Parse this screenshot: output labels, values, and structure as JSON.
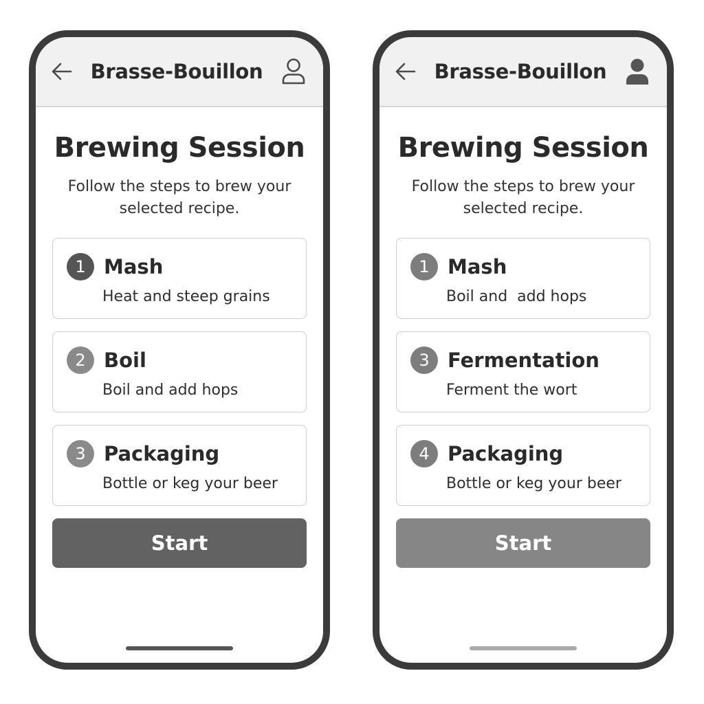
{
  "phones": [
    {
      "header": {
        "title": "Brasse-Bouillon",
        "back_icon": "arrow-left-icon",
        "user_icon": "user-outline-icon"
      },
      "page": {
        "title": "Brewing Session",
        "subtitle": "Follow the steps to brew your selected recipe."
      },
      "steps": [
        {
          "number": "1",
          "title": "Mash",
          "description": "Heat and steep grains"
        },
        {
          "number": "2",
          "title": "Boil",
          "description": "Boil and add hops"
        },
        {
          "number": "3",
          "title": "Packaging",
          "description": "Bottle or keg your beer"
        }
      ],
      "start_label": "Start",
      "colors": {
        "badge_first": "#555555",
        "badge_other": "#8a8a8a",
        "button": "#626262",
        "home_indicator": "#555555"
      }
    },
    {
      "header": {
        "title": "Brasse-Bouillon",
        "back_icon": "arrow-left-icon",
        "user_icon": "user-filled-icon"
      },
      "page": {
        "title": "Brewing Session",
        "subtitle": "Follow the steps to brew your selected recipe."
      },
      "steps": [
        {
          "number": "1",
          "title": "Mash",
          "description": "Boil and  add hops"
        },
        {
          "number": "3",
          "title": "Fermentation",
          "description": "Ferment the wort"
        },
        {
          "number": "4",
          "title": "Packaging",
          "description": "Bottle or keg your beer"
        }
      ],
      "start_label": "Start",
      "colors": {
        "badge_first": "#7d7d7d",
        "badge_other": "#7d7d7d",
        "button": "#868686",
        "home_indicator": "#aaaaaa"
      }
    }
  ]
}
